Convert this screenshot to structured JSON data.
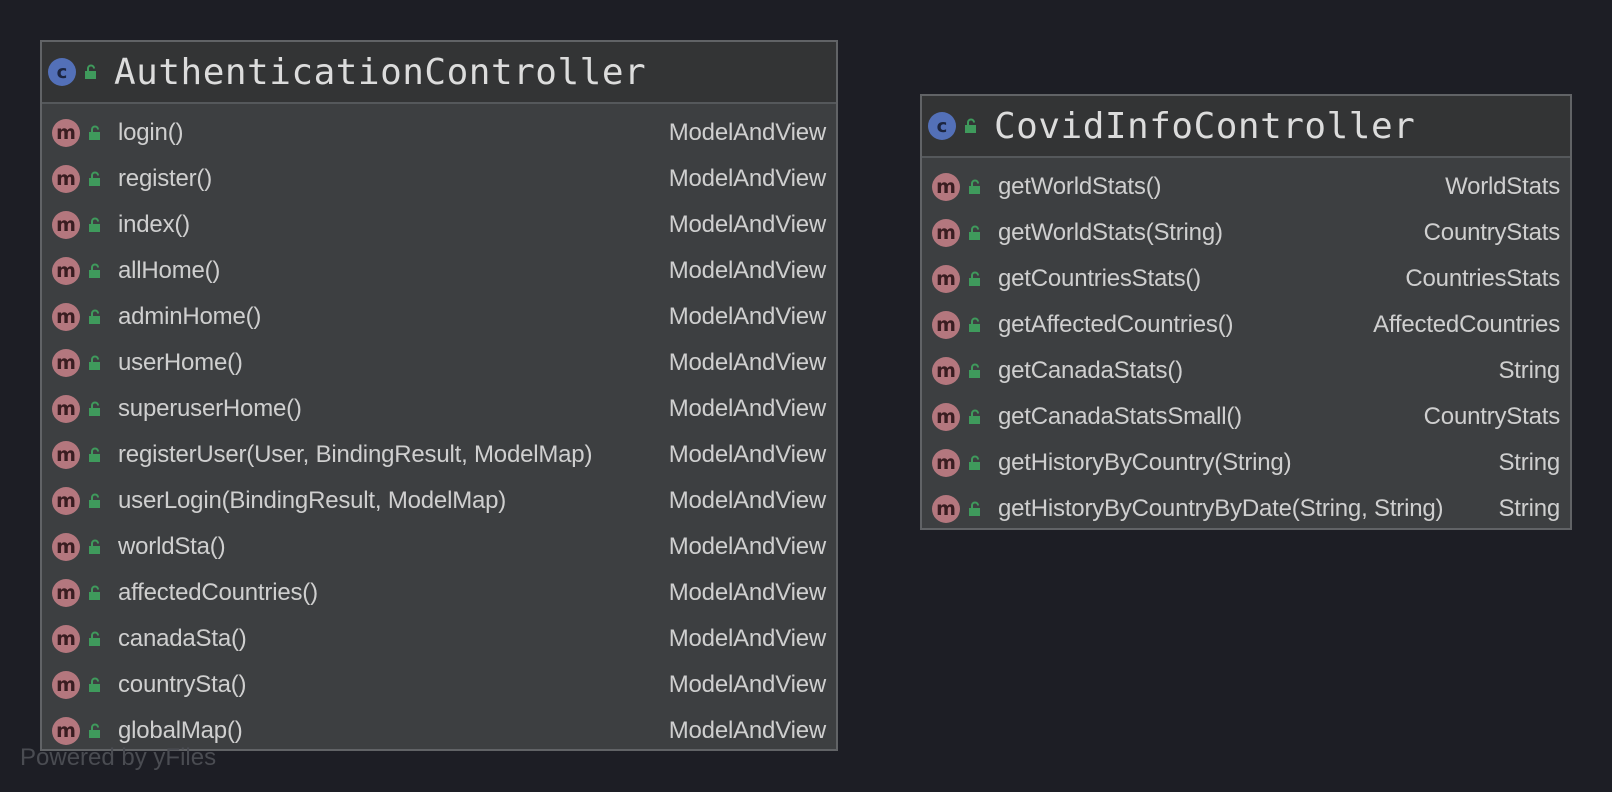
{
  "classes": [
    {
      "name": "AuthenticationController",
      "kind_icon": "class-icon",
      "kind_letter": "c",
      "members": [
        {
          "name": "login()",
          "type": "ModelAndView"
        },
        {
          "name": "register()",
          "type": "ModelAndView"
        },
        {
          "name": "index()",
          "type": "ModelAndView"
        },
        {
          "name": "allHome()",
          "type": "ModelAndView"
        },
        {
          "name": "adminHome()",
          "type": "ModelAndView"
        },
        {
          "name": "userHome()",
          "type": "ModelAndView"
        },
        {
          "name": "superuserHome()",
          "type": "ModelAndView"
        },
        {
          "name": "registerUser(User, BindingResult, ModelMap)",
          "type": "ModelAndView"
        },
        {
          "name": "userLogin(BindingResult, ModelMap)",
          "type": "ModelAndView"
        },
        {
          "name": "worldSta()",
          "type": "ModelAndView"
        },
        {
          "name": "affectedCountries()",
          "type": "ModelAndView"
        },
        {
          "name": "canadaSta()",
          "type": "ModelAndView"
        },
        {
          "name": "countrySta()",
          "type": "ModelAndView"
        },
        {
          "name": "globalMap()",
          "type": "ModelAndView"
        }
      ]
    },
    {
      "name": "CovidInfoController",
      "kind_icon": "class-icon",
      "kind_letter": "c",
      "members": [
        {
          "name": "getWorldStats()",
          "type": "WorldStats"
        },
        {
          "name": "getWorldStats(String)",
          "type": "CountryStats"
        },
        {
          "name": "getCountriesStats()",
          "type": "CountriesStats"
        },
        {
          "name": "getAffectedCountries()",
          "type": "AffectedCountries"
        },
        {
          "name": "getCanadaStats()",
          "type": "String"
        },
        {
          "name": "getCanadaStatsSmall()",
          "type": "CountryStats"
        },
        {
          "name": "getHistoryByCountry(String)",
          "type": "String"
        },
        {
          "name": "getHistoryByCountryByDate(String, String)",
          "type": "String"
        }
      ]
    }
  ],
  "method_icon_letter": "m",
  "icons": {
    "class": "class-icon",
    "method": "method-icon",
    "visibility": "public-lock-icon"
  },
  "colors": {
    "background": "#1d1e25",
    "class_icon": "#5370b8",
    "method_icon": "#b4777e",
    "lock": "#3f9a5c"
  },
  "watermark": "Powered by yFiles"
}
